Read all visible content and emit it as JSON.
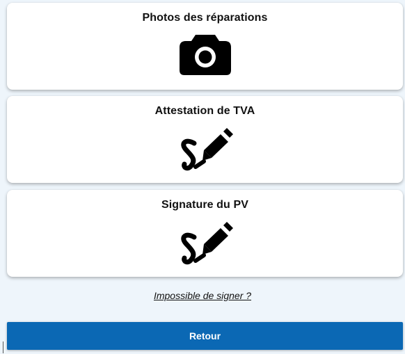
{
  "cards": [
    {
      "title": "Photos des réparations",
      "icon": "camera-icon"
    },
    {
      "title": "Attestation de TVA",
      "icon": "signature-pen-icon"
    },
    {
      "title": "Signature du PV",
      "icon": "signature-pen-icon"
    }
  ],
  "link": {
    "label": "Impossible de signer ?"
  },
  "bottom_button": {
    "label": "Retour",
    "color": "#0b68b4"
  },
  "colors": {
    "background": "#eef5fb",
    "card": "#ffffff",
    "text": "#111111"
  }
}
